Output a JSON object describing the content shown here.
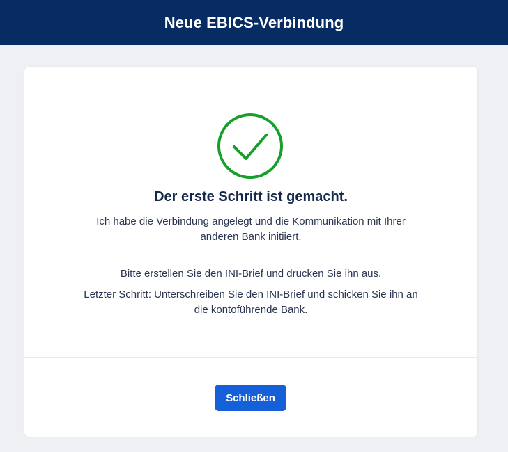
{
  "header": {
    "title": "Neue EBICS-Verbindung"
  },
  "dialog": {
    "icon": "success-check-icon",
    "accent_color": "#16a02b",
    "heading": "Der erste Schritt ist gemacht.",
    "paragraphs": [
      "Ich habe die Verbindung angelegt und die Kommunikation mit Ihrer anderen Bank initiiert.",
      "Bitte erstellen Sie den INI-Brief und drucken Sie ihn aus.",
      "Letzter Schritt: Unterschreiben Sie den INI-Brief und schicken Sie ihn an die kontoführende Bank."
    ],
    "close_button_label": "Schließen",
    "button_color": "#155fd8"
  }
}
